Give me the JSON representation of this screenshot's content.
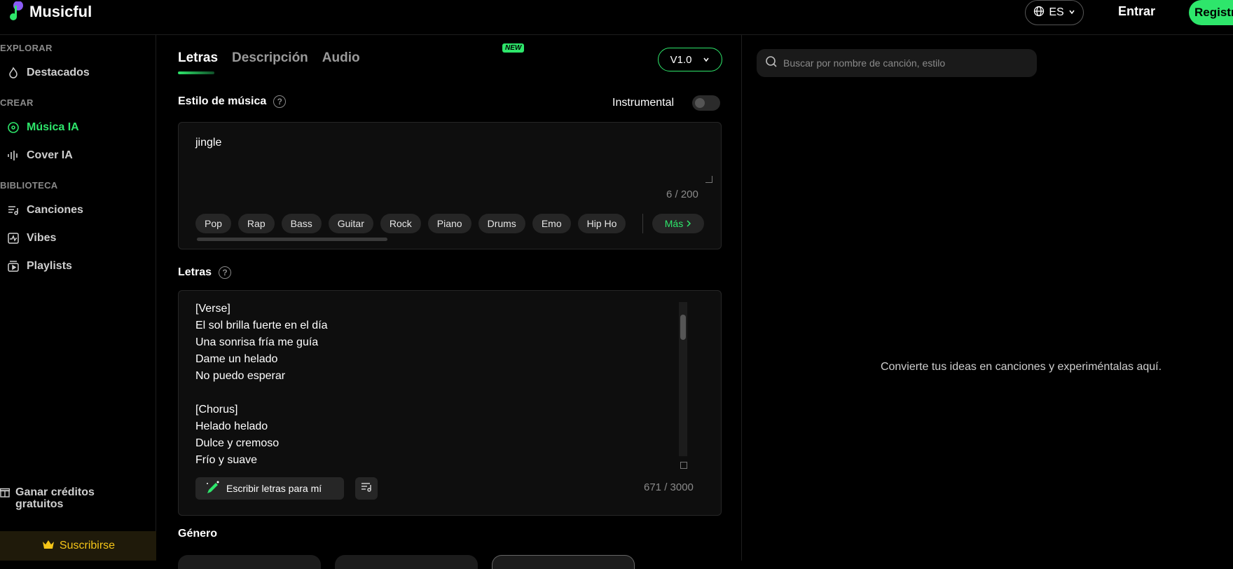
{
  "header": {
    "app_name": "Musicful",
    "language": "ES",
    "login_label": "Entrar",
    "register_label": "Registrarse"
  },
  "sidebar": {
    "sections": {
      "explore": "EXPLORAR",
      "create": "CREAR",
      "library": "BIBLIOTECA"
    },
    "items": {
      "featured": "Destacados",
      "ai_music": "Música IA",
      "ai_cover": "Cover IA",
      "songs": "Canciones",
      "vibes": "Vibes",
      "playlists": "Playlists"
    },
    "credits_line1": "Ganar créditos",
    "credits_line2": "gratuitos",
    "subscribe_label": "Suscribirse"
  },
  "main": {
    "tabs": [
      "Letras",
      "Descripción",
      "Audio"
    ],
    "new_badge": "NEW",
    "version": "V1.0",
    "style_label": "Estilo de música",
    "instrumental_label": "Instrumental",
    "style_value": "jingle",
    "style_counter": "6 / 200",
    "chips": [
      "Pop",
      "Rap",
      "Bass",
      "Guitar",
      "Rock",
      "Piano",
      "Drums",
      "Emo",
      "Hip Ho"
    ],
    "more_label": "Más",
    "lyrics_label": "Letras",
    "lyrics_lines": [
      "[Verse]",
      "El sol brilla fuerte en el día",
      "Una sonrisa fría me guía",
      "Dame un helado",
      "No puedo esperar",
      "",
      "[Chorus]",
      "Helado helado",
      "Dulce y cremoso",
      "Frío y suave"
    ],
    "write_lyrics_label": "Escribir letras para mí",
    "lyrics_counter": "671 / 3000",
    "genre_label": "Género"
  },
  "right": {
    "search_placeholder": "Buscar por nombre de canción, estilo",
    "empty_message": "Convierte tus ideas en canciones y experiméntalas aquí."
  },
  "colors": {
    "accent": "#2ee66b",
    "gold": "#f5c518",
    "background": "#000000",
    "panel": "#0e0e0e"
  }
}
